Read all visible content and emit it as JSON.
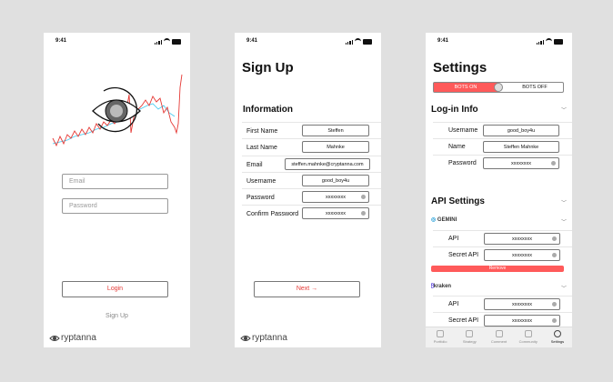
{
  "status": {
    "time": "9:41"
  },
  "login": {
    "email_placeholder": "Email",
    "password_placeholder": "Password",
    "login_label": "Login",
    "signup_label": "Sign Up",
    "brand": "ryptanna"
  },
  "signup": {
    "title": "Sign Up",
    "section": "Information",
    "fields": [
      {
        "label": "First Name",
        "value": "Steffen"
      },
      {
        "label": "Last Name",
        "value": "Mahnke"
      },
      {
        "label": "Email",
        "value": "steffen.mahnke@cryptanna.com"
      },
      {
        "label": "Username",
        "value": "good_boy4u"
      },
      {
        "label": "Password",
        "value": "xxxxxxxx"
      },
      {
        "label": "Confirm Password",
        "value": "xxxxxxxx"
      }
    ],
    "next_label": "Next",
    "brand": "ryptanna"
  },
  "settings": {
    "title": "Settings",
    "bots_on": "BOTS ON",
    "bots_off": "BOTS OFF",
    "login_info": "Log-in Info",
    "username_label": "Username",
    "username_value": "good_boy4u",
    "name_label": "Name",
    "name_value": "Steffen Mahnke",
    "password_label": "Password",
    "password_value": "xxxxxxxx",
    "api_settings": "API Settings",
    "gemini": "GEMINI",
    "api_label": "API",
    "api_value": "xxxxxxxx",
    "secret_label": "Secret API",
    "secret_value": "xxxxxxxx",
    "remove_label": "Remove",
    "kraken": "kraken",
    "api2_value": "xxxxxxxx",
    "secret2_value": "xxxxxxxx",
    "tabs": [
      "Portfolio",
      "Strategy",
      "Comment",
      "Community",
      "Settings"
    ]
  },
  "colors": {
    "accent": "#ff5a5a",
    "login_text": "#e53935"
  }
}
